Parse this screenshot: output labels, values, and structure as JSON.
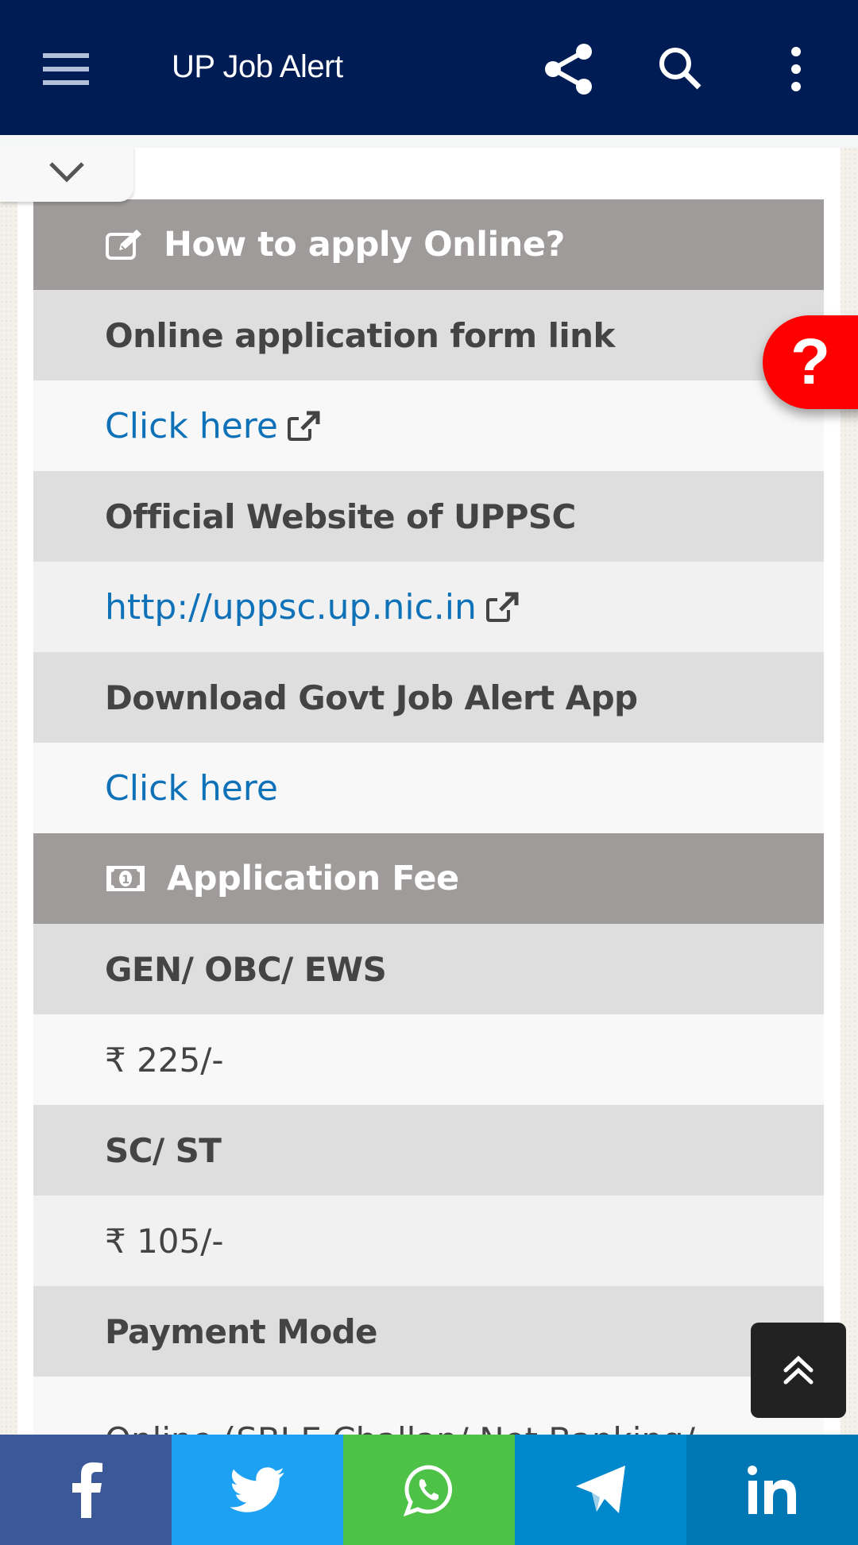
{
  "app_bar": {
    "title": "UP Job Alert",
    "icons": [
      "menu-icon",
      "share-icon",
      "search-icon",
      "more-vert-icon"
    ]
  },
  "help_button": {
    "label": "?"
  },
  "sections": [
    {
      "title": "How to apply Online?",
      "icon": "edit-icon",
      "rows": [
        {
          "label": "Online application form link",
          "value": "Click here",
          "link": true,
          "external": true
        },
        {
          "label": "Official Website of UPPSC",
          "value": "http://uppsc.up.nic.in",
          "link": true,
          "external": true
        },
        {
          "label": "Download Govt Job Alert App",
          "value": "Click here",
          "link": true,
          "external": false
        }
      ]
    },
    {
      "title": "Application Fee",
      "icon": "money-icon",
      "rows": [
        {
          "label": "GEN/ OBC/ EWS",
          "value": "₹ 225/-"
        },
        {
          "label": "SC/ ST",
          "value": "₹ 105/-"
        },
        {
          "label": "Payment Mode",
          "value": "Online (SBI E Challan/ Net Banking/"
        }
      ]
    }
  ],
  "share_bar": [
    {
      "name": "facebook",
      "color": "#3b5998"
    },
    {
      "name": "twitter",
      "color": "#1da1f2"
    },
    {
      "name": "whatsapp",
      "color": "#4dc247"
    },
    {
      "name": "telegram",
      "color": "#0088cc"
    },
    {
      "name": "linkedin",
      "color": "#0077b5"
    }
  ],
  "colors": {
    "app_bar": "#001c55",
    "section_header": "#9e9b9a",
    "label_row": "#dedede",
    "link": "#0f72b8",
    "help_button": "#ff0000"
  }
}
